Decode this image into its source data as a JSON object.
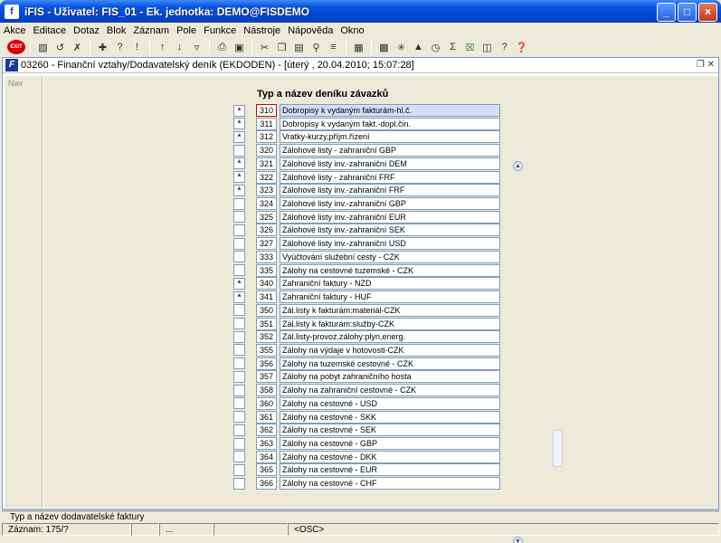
{
  "window": {
    "title": "iFIS - Uživatel: FIS_01 - Ek. jednotka: DEMO@FISDEMO",
    "app_icon": "f-icon",
    "buttons": [
      "_",
      "□",
      "×"
    ]
  },
  "menu": [
    "Akce",
    "Editace",
    "Dotaz",
    "Blok",
    "Záznam",
    "Pole",
    "Funkce",
    "Nástroje",
    "Nápověda",
    "Okno"
  ],
  "toolbar": {
    "exit_label": "EXIT",
    "icons": [
      "save-icon",
      "rollback-icon",
      "delete-icon",
      "insert-record-icon",
      "query-icon",
      "execute-query-icon",
      "sort-asc-icon",
      "sort-desc-icon",
      "filter-icon",
      "print-icon",
      "print-preview-icon",
      "cut-icon",
      "copy-icon",
      "paste-icon",
      "find-icon",
      "list-icon",
      "grid-icon",
      "report-icon",
      "calc-icon",
      "chart-icon",
      "calendar-icon",
      "sum-icon",
      "excel-icon",
      "export-icon",
      "help-icon",
      "context-help-icon"
    ]
  },
  "form": {
    "title": "03260 - Finanční vztahy/Dodavatelský deník (EKDODEN) - [úterý  , 20.04.2010; 15:07:28]",
    "nav_label": "Nav",
    "column_header": "Typ a název deníku závazků",
    "rows": [
      {
        "checked": "*",
        "code": "310",
        "name": "Dobropisy k vydaným fakturám-hl.č."
      },
      {
        "checked": "*",
        "code": "311",
        "name": "Dobropisy k vydaným fakt.-dopl.čin."
      },
      {
        "checked": "*",
        "code": "312",
        "name": "Vratky-kurzy,příjm.řízení"
      },
      {
        "checked": "",
        "code": "320",
        "name": "Zálohové listy - zahraniční GBP"
      },
      {
        "checked": "*",
        "code": "321",
        "name": "Zálohové listy inv.-zahraniční DEM"
      },
      {
        "checked": "*",
        "code": "322",
        "name": "Zálohové listy - zahraniční FRF"
      },
      {
        "checked": "*",
        "code": "323",
        "name": "Zálohové listy inv.-zahraniční FRF"
      },
      {
        "checked": "",
        "code": "324",
        "name": "Zálohové listy inv.-zahraniční GBP"
      },
      {
        "checked": "",
        "code": "325",
        "name": "Zálohové listy inv.-zahraniční EUR"
      },
      {
        "checked": "",
        "code": "326",
        "name": "Zálohové listy inv.-zahraniční SEK"
      },
      {
        "checked": "",
        "code": "327",
        "name": "Zálohové listy inv.-zahraniční USD"
      },
      {
        "checked": "",
        "code": "333",
        "name": "Vyúčtování služební cesty - CZK"
      },
      {
        "checked": "",
        "code": "335",
        "name": "Zálohy na cestovné tuzemské - CZK"
      },
      {
        "checked": "*",
        "code": "340",
        "name": "Zahraniční faktury - NZD"
      },
      {
        "checked": "*",
        "code": "341",
        "name": "Zahraniční faktury - HUF"
      },
      {
        "checked": "",
        "code": "350",
        "name": "Zál.listy k fakturám:materiál-CZK"
      },
      {
        "checked": "",
        "code": "351",
        "name": "Zál.listy k fakturám:služby-CZK"
      },
      {
        "checked": "",
        "code": "352",
        "name": "Zál.listy-provoz.zálohy:plyn,energ."
      },
      {
        "checked": "",
        "code": "355",
        "name": "Zálohy na výdaje v hotovosti-CZK"
      },
      {
        "checked": "",
        "code": "356",
        "name": "Zálohy na tuzemské cestovné - CZK"
      },
      {
        "checked": "",
        "code": "357",
        "name": "Zálohy na pobyt zahraničního hosta"
      },
      {
        "checked": "",
        "code": "358",
        "name": "Zálohy na zahraniční cestovné - CZK"
      },
      {
        "checked": "",
        "code": "360",
        "name": "Zálohy na cestovné - USD"
      },
      {
        "checked": "",
        "code": "361",
        "name": "Zálohy na cestovné - SKK"
      },
      {
        "checked": "",
        "code": "362",
        "name": "Zálohy na cestovné - SEK"
      },
      {
        "checked": "",
        "code": "363",
        "name": "Zálohy na cestovné - GBP"
      },
      {
        "checked": "",
        "code": "364",
        "name": "Zálohy na cestovné - DKK"
      },
      {
        "checked": "",
        "code": "365",
        "name": "Zálohy na cestovné - EUR"
      },
      {
        "checked": "",
        "code": "366",
        "name": "Zálohy na cestovné - CHF"
      }
    ]
  },
  "hint": "Typ a název dodavatelské faktury",
  "status": {
    "record": "Záznam: 175/?",
    "seg2": "",
    "seg3": "...",
    "seg4": "",
    "mode": "<OSC>"
  }
}
